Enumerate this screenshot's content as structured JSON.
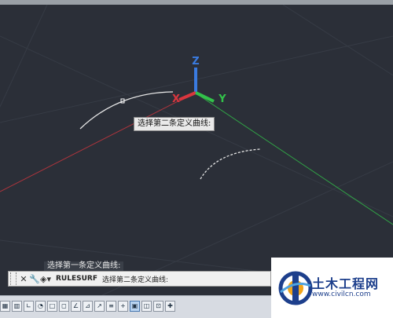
{
  "viewport": {
    "axes": {
      "z_label": "Z",
      "x_label": "X",
      "y_label": "Y"
    },
    "tooltip": "选择第二条定义曲线:",
    "colors": {
      "background": "#2b2f38",
      "x_axis": "#d9363e",
      "y_axis": "#32c24a",
      "z_axis": "#3a7be0",
      "curve": "#e6e6e6"
    }
  },
  "command_line": {
    "history": "选择第一条定义曲线:",
    "icons": {
      "close": "close-icon",
      "settings": "wrench-icon",
      "command": "ruled-surface-icon"
    },
    "command_name": "RULESURF",
    "prompt": "选择第二条定义曲线:"
  },
  "status_bar": {
    "tools": [
      {
        "name": "grid-icon",
        "glyph": "▦",
        "on": false
      },
      {
        "name": "snap-icon",
        "glyph": "▥",
        "on": false
      },
      {
        "name": "ortho-icon",
        "glyph": "∟",
        "on": false
      },
      {
        "name": "polar-icon",
        "glyph": "◔",
        "on": false
      },
      {
        "name": "osnap-icon",
        "glyph": "□",
        "on": false
      },
      {
        "name": "3d-osnap-icon",
        "glyph": "◻",
        "on": false
      },
      {
        "name": "otrack-icon",
        "glyph": "∠",
        "on": false
      },
      {
        "name": "ducs-icon",
        "glyph": "⊿",
        "on": false
      },
      {
        "name": "dyn-icon",
        "glyph": "↗",
        "on": false
      },
      {
        "name": "lineweight-icon",
        "glyph": "≡",
        "on": false
      },
      {
        "name": "transparency-icon",
        "glyph": "+",
        "on": false
      },
      {
        "name": "quick-properties-icon",
        "glyph": "▣",
        "on": true
      },
      {
        "name": "selection-cycling-icon",
        "glyph": "◫",
        "on": false
      },
      {
        "name": "annotation-monitor-icon",
        "glyph": "⊡",
        "on": false
      },
      {
        "name": "workspace-icon",
        "glyph": "✚",
        "on": false
      }
    ]
  },
  "watermark": {
    "brand": "土木工程网",
    "url": "www.civilcn.com"
  }
}
